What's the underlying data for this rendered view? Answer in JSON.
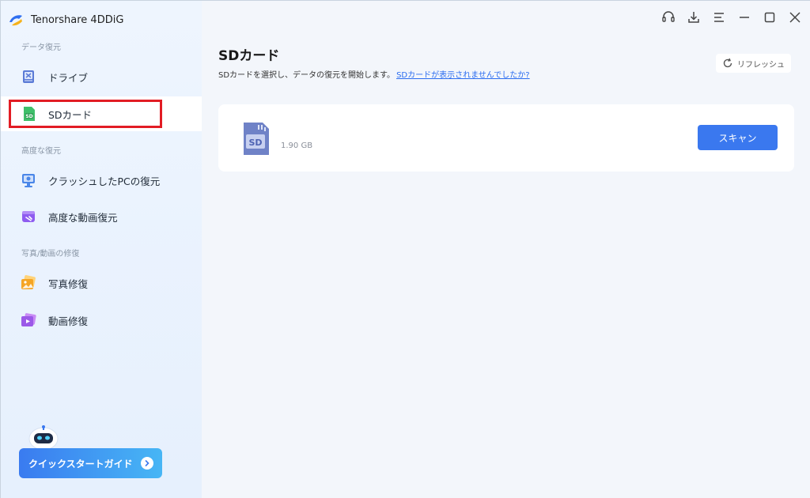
{
  "app": {
    "name": "Tenorshare 4DDiG"
  },
  "sidebar": {
    "sections": [
      {
        "label": "データ復元"
      },
      {
        "label": "高度な復元"
      },
      {
        "label": "写真/動画の修復"
      }
    ],
    "items": [
      {
        "label": "ドライブ",
        "icon": "drive-icon"
      },
      {
        "label": "SDカード",
        "icon": "sd-card-icon",
        "active": true
      },
      {
        "label": "クラッシュしたPCの復元",
        "icon": "crashed-pc-icon"
      },
      {
        "label": "高度な動画復元",
        "icon": "video-recovery-icon"
      },
      {
        "label": "写真修復",
        "icon": "photo-repair-icon"
      },
      {
        "label": "動画修復",
        "icon": "video-repair-icon"
      }
    ],
    "guide_button": "クイックスタートガイド"
  },
  "header": {
    "title": "SDカード",
    "subtitle": "SDカードを選択し、データの復元を開始します。",
    "help_link": "SDカードが表示されませんでしたか?",
    "refresh_label": "リフレッシュ"
  },
  "device_card": {
    "size": "1.90 GB",
    "scan_label": "スキャン"
  },
  "colors": {
    "accent": "#3a78ef",
    "highlight": "#e21c24",
    "sidebar_bg": "#eaf3fe"
  }
}
